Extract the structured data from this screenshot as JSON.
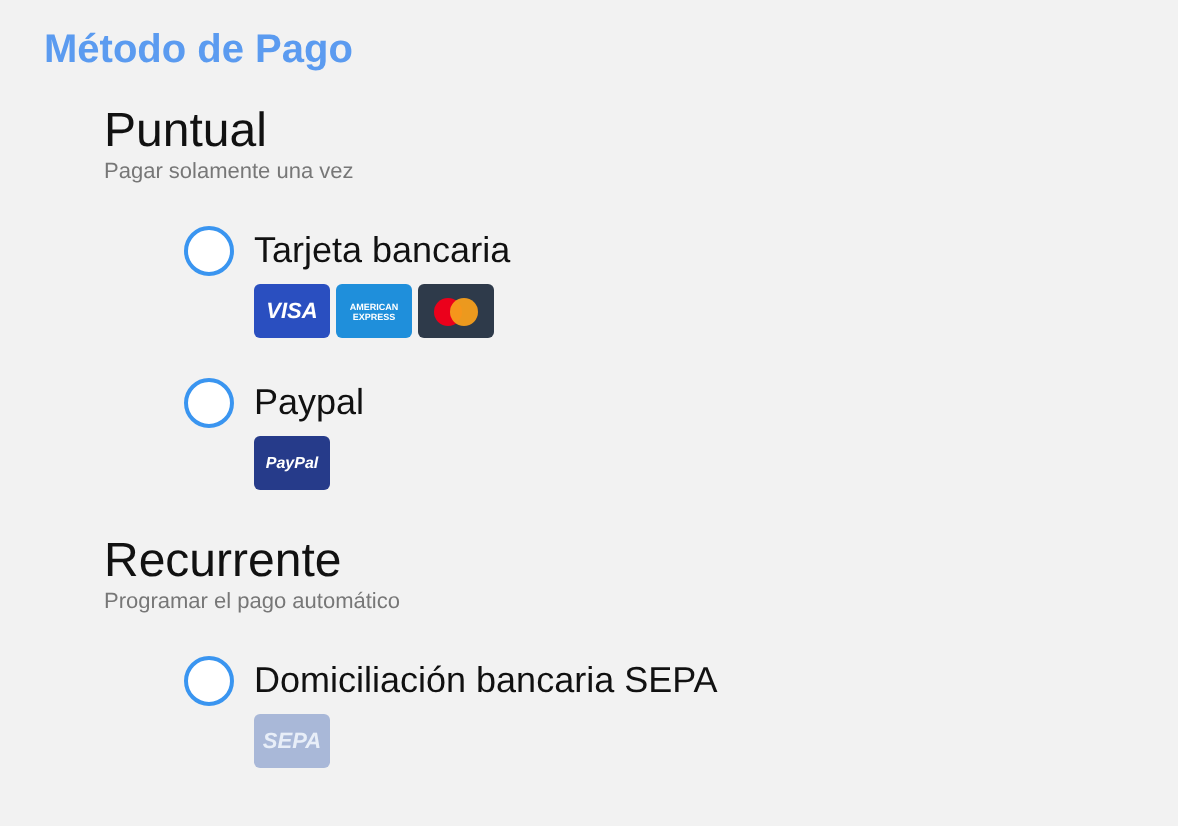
{
  "title": "Método de Pago",
  "sections": [
    {
      "heading": "Puntual",
      "subtitle": "Pagar solamente una vez",
      "methods": [
        {
          "label": "Tarjeta bancaria",
          "selected": false,
          "badges": [
            {
              "kind": "visa",
              "text": "VISA"
            },
            {
              "kind": "amex",
              "text": "AMERICAN EXPRESS"
            },
            {
              "kind": "mastercard"
            }
          ]
        },
        {
          "label": "Paypal",
          "selected": false,
          "badges": [
            {
              "kind": "paypal",
              "text": "PayPal"
            }
          ]
        }
      ]
    },
    {
      "heading": "Recurrente",
      "subtitle": "Programar el pago automático",
      "methods": [
        {
          "label": "Domiciliación bancaria SEPA",
          "selected": false,
          "badges": [
            {
              "kind": "sepa",
              "text": "SEPA"
            }
          ]
        }
      ]
    }
  ]
}
